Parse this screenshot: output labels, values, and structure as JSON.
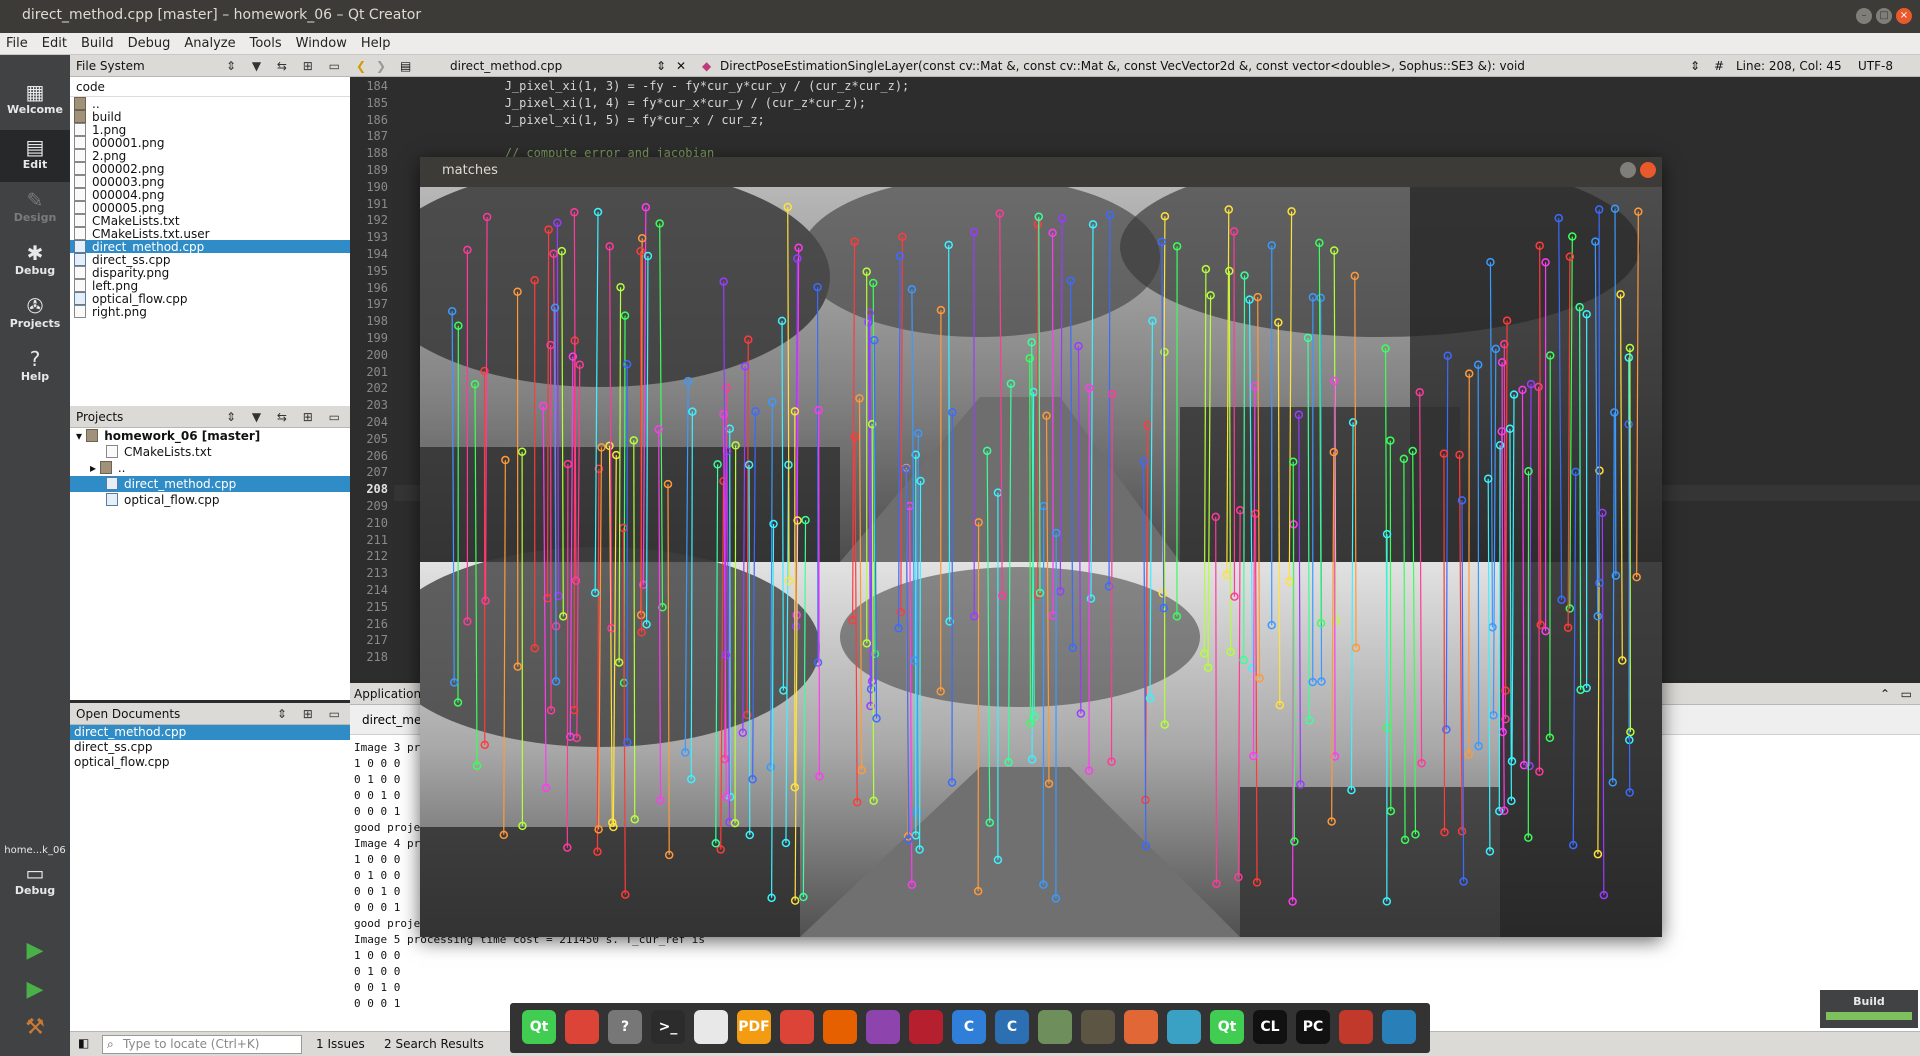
{
  "window": {
    "title": "direct_method.cpp [master] – homework_06 – Qt Creator"
  },
  "menu": [
    "File",
    "Edit",
    "Build",
    "Debug",
    "Analyze",
    "Tools",
    "Window",
    "Help"
  ],
  "modes": [
    {
      "label": "Welcome",
      "icon": "grid-icon"
    },
    {
      "label": "Edit",
      "icon": "edit-icon"
    },
    {
      "label": "Design",
      "icon": "design-icon"
    },
    {
      "label": "Debug",
      "icon": "bug-icon"
    },
    {
      "label": "Projects",
      "icon": "wrench-icon"
    },
    {
      "label": "Help",
      "icon": "help-icon"
    }
  ],
  "kit": {
    "name": "home...k_06",
    "mode": "Debug"
  },
  "filesystem": {
    "title": "File System",
    "root": "code",
    "items": [
      "..",
      "build",
      "1.png",
      "000001.png",
      "2.png",
      "000002.png",
      "000003.png",
      "000004.png",
      "000005.png",
      "CMakeLists.txt",
      "CMakeLists.txt.user",
      "direct_method.cpp",
      "direct_ss.cpp",
      "disparity.png",
      "left.png",
      "optical_flow.cpp",
      "right.png"
    ],
    "selected": "direct_method.cpp"
  },
  "projects": {
    "title": "Projects",
    "root": "homework_06 [master]",
    "items": [
      "CMakeLists.txt",
      "..",
      "direct_method.cpp",
      "optical_flow.cpp"
    ],
    "selected": "direct_method.cpp"
  },
  "open_documents": {
    "title": "Open Documents",
    "items": [
      "direct_method.cpp",
      "direct_ss.cpp",
      "optical_flow.cpp"
    ],
    "selected": "direct_method.cpp"
  },
  "editor": {
    "file": "direct_method.cpp",
    "symbol": "DirectPoseEstimationSingleLayer(const cv::Mat &, const cv::Mat &, const VecVector2d &, const vector<double>, Sophus::SE3 &): void",
    "position": "Line: 208, Col: 45",
    "encoding": "UTF-8",
    "line_numbers": [
      "184",
      "185",
      "186",
      "187",
      "188",
      "189",
      "190",
      "191",
      "192",
      "193",
      "194",
      "195",
      "196",
      "197",
      "198",
      "199",
      "200",
      "201",
      "202",
      "203",
      "204",
      "205",
      "206",
      "207",
      "208",
      "209",
      "210",
      "211",
      "212",
      "213",
      "214",
      "215",
      "216",
      "217",
      "218"
    ],
    "current_line": "208",
    "code_lines": [
      "            J_pixel_xi(1, 3) = -fy - fy*cur_y*cur_y / (cur_z*cur_z);",
      "            J_pixel_xi(1, 4) = fy*cur_x*cur_y / (cur_z*cur_z);",
      "            J_pixel_xi(1, 5) = fy*cur_x / cur_z;",
      "",
      "            // compute error and jacobian"
    ]
  },
  "output": {
    "header": "Application",
    "tab": "direct_me",
    "lines": [
      "Image 3 pr",
      "1 0 0 0",
      "0 1 0 0",
      "0 0 1 0",
      "0 0 0 1",
      "good proje",
      "Image 4 pr",
      "1 0 0 0",
      "0 1 0 0",
      "0 0 1 0",
      "0 0 0 1",
      "good proje",
      "Image 5 processing time cost = 211450 s. T_cur_ref is",
      "1 0 0 0",
      "0 1 0 0",
      "0 0 1 0",
      "0 0 0 1"
    ]
  },
  "statusbar": {
    "locate_placeholder": "Type to locate (Ctrl+K)",
    "issues": "1  Issues",
    "search": "2  Search Results"
  },
  "matches_window": {
    "title": "matches"
  },
  "dock": [
    {
      "name": "qt-icon",
      "label": "Qt",
      "color": "#41cd52"
    },
    {
      "name": "chrome-icon",
      "label": "",
      "color": "#db4437"
    },
    {
      "name": "unknown-app-icon",
      "label": "?",
      "color": "#777777"
    },
    {
      "name": "terminal-icon",
      "label": ">_",
      "color": "#2c2c2c"
    },
    {
      "name": "text-editor-icon",
      "label": "",
      "color": "#e8e8e8"
    },
    {
      "name": "pdf-icon",
      "label": "PDF",
      "color": "#f39c12"
    },
    {
      "name": "chrome-icon-2",
      "label": "",
      "color": "#db4437"
    },
    {
      "name": "firefox-icon",
      "label": "",
      "color": "#e66000"
    },
    {
      "name": "video-icon",
      "label": "",
      "color": "#8e44ad"
    },
    {
      "name": "mendeley-icon",
      "label": "",
      "color": "#b61f2e"
    },
    {
      "name": "clion-c-icon",
      "label": "C",
      "color": "#2f7fd8"
    },
    {
      "name": "c-app-icon",
      "label": "C",
      "color": "#2c6fb3"
    },
    {
      "name": "eye-app-icon",
      "label": "",
      "color": "#6e8f5c"
    },
    {
      "name": "gimp-icon",
      "label": "",
      "color": "#5c5543"
    },
    {
      "name": "matlab-icon",
      "label": "",
      "color": "#e16737"
    },
    {
      "name": "network-app-icon",
      "label": "",
      "color": "#3aa0c4"
    },
    {
      "name": "qt-icon-2",
      "label": "Qt",
      "color": "#41cd52"
    },
    {
      "name": "clion-icon",
      "label": "CL",
      "color": "#111111"
    },
    {
      "name": "pycharm-icon",
      "label": "PC",
      "color": "#111111"
    },
    {
      "name": "books-app-icon",
      "label": "",
      "color": "#c0392b"
    },
    {
      "name": "virtualbox-icon",
      "label": "",
      "color": "#2980b9"
    }
  ],
  "build": {
    "label": "Build"
  }
}
